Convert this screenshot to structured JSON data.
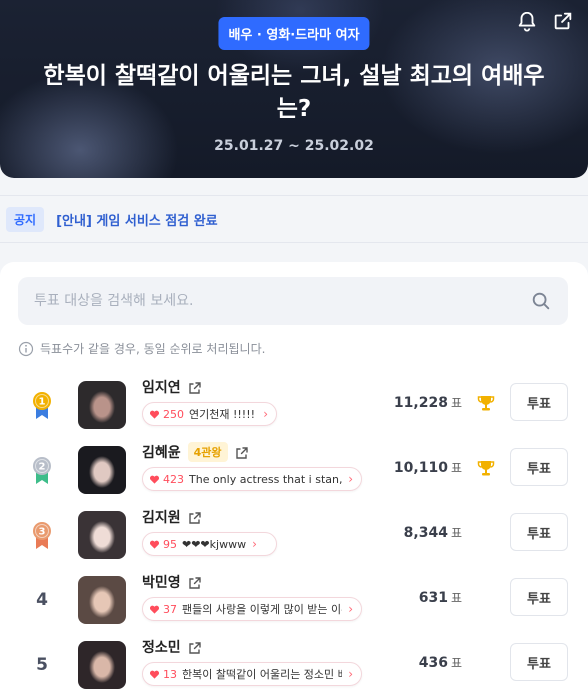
{
  "header": {
    "category": "배우 · 영화·드라마 여자",
    "title": "한복이 찰떡같이 어울리는 그녀, 설날 최고의 여배우는?",
    "dates": "25.01.27 ~ 25.02.02",
    "icons": [
      "bell-icon",
      "share-icon"
    ]
  },
  "notice": {
    "tag": "공지",
    "text": "[안내] 게임 서비스 점검 완료"
  },
  "search": {
    "placeholder": "투표 대상을 검색해 보세요."
  },
  "info_text": "득표수가 같을 경우, 동일 순위로 처리됩니다.",
  "vote_unit": "표",
  "vote_button_label": "투표",
  "ranking": [
    {
      "rank": "1",
      "medal_color": "#f2b100",
      "ribbon_color": "#3b7de0",
      "name": "임지연",
      "badge": "",
      "comment_count": "250",
      "comment": "연기천재 !!!!! ⭐",
      "votes": "11,228",
      "trophy": true
    },
    {
      "rank": "2",
      "medal_color": "#b8bec9",
      "ribbon_color": "#3ebd8a",
      "name": "김혜윤",
      "badge": "4관왕",
      "comment_count": "423",
      "comment": "The only actress that i stan, tru",
      "votes": "10,110",
      "trophy": true
    },
    {
      "rank": "3",
      "medal_color": "#e99a6e",
      "ribbon_color": "#e97b56",
      "name": "김지원",
      "badge": "",
      "comment_count": "95",
      "comment": "❤❤❤kjwww",
      "votes": "8,344",
      "trophy": false
    },
    {
      "rank": "4",
      "name": "박민영",
      "badge": "",
      "comment_count": "37",
      "comment": "팬들의 사랑을 이렇게 많이 받는 이유",
      "votes": "631",
      "trophy": false
    },
    {
      "rank": "5",
      "name": "정소민",
      "badge": "",
      "comment_count": "13",
      "comment": "한복이 찰떡같이 어울리는 정소민 배",
      "votes": "436",
      "trophy": false
    }
  ]
}
